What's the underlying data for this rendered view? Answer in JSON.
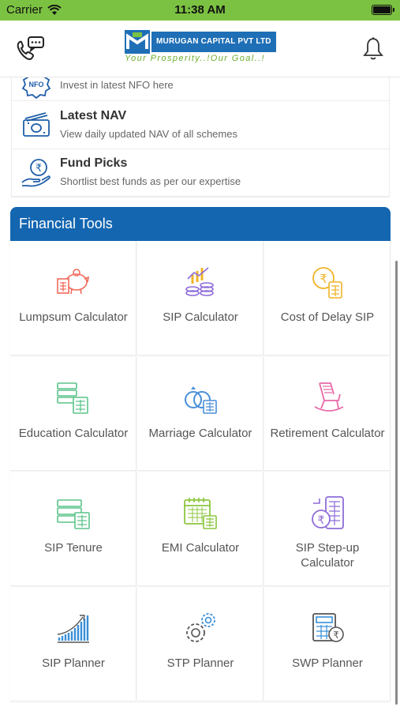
{
  "status_bar": {
    "carrier": "Carrier",
    "time": "11:38 AM"
  },
  "header": {
    "logo_name": "MURUGAN CAPITAL PVT LTD",
    "logo_tagline": "Your Prosperity..!Our Goal..!",
    "icons": {
      "contact": "phone-chat-icon",
      "notifications": "bell-icon"
    }
  },
  "menu": [
    {
      "title": "",
      "desc": "Invest in latest NFO here",
      "icon": "nfo-icon",
      "icon_text": "NFO"
    },
    {
      "title": "Latest NAV",
      "desc": "View daily updated NAV of all schemes",
      "icon": "money-notes-icon"
    },
    {
      "title": "Fund Picks",
      "desc": "Shortlist best funds as per our expertise",
      "icon": "hand-rupee-icon"
    }
  ],
  "financial_tools": {
    "title": "Financial Tools",
    "tools": [
      {
        "label": "Lumpsum Calculator",
        "icon": "piggy-bank-calculator-icon",
        "color": "#f26b5b"
      },
      {
        "label": "SIP Calculator",
        "icon": "coins-chart-icon",
        "color": "#8e6cd9"
      },
      {
        "label": "Cost of Delay SIP",
        "icon": "rupee-coin-calculator-icon",
        "color": "#f0b429"
      },
      {
        "label": "Education Calculator",
        "icon": "education-calculator-icon",
        "color": "#5cc48a"
      },
      {
        "label": "Marriage Calculator",
        "icon": "rings-calculator-icon",
        "color": "#4a8fd8"
      },
      {
        "label": "Retirement Calculator",
        "icon": "rocking-chair-icon",
        "color": "#e86aa8"
      },
      {
        "label": "SIP Tenure",
        "icon": "tenure-calculator-icon",
        "color": "#5cc48a"
      },
      {
        "label": "EMI Calculator",
        "icon": "calendar-calculator-icon",
        "color": "#8cc63f"
      },
      {
        "label": "SIP Step-up Calculator",
        "icon": "phone-rupee-calculator-icon",
        "color": "#8e6cd9"
      },
      {
        "label": "SIP Planner",
        "icon": "growth-bars-icon",
        "color": "#3a8fd8"
      },
      {
        "label": "STP Planner",
        "icon": "gears-icon",
        "color": "#555555"
      },
      {
        "label": "SWP Planner",
        "icon": "calculator-rupee-icon",
        "color": "#3a8fd8"
      }
    ]
  },
  "colors": {
    "status_green": "#7cc242",
    "brand_blue": "#1466b0"
  }
}
